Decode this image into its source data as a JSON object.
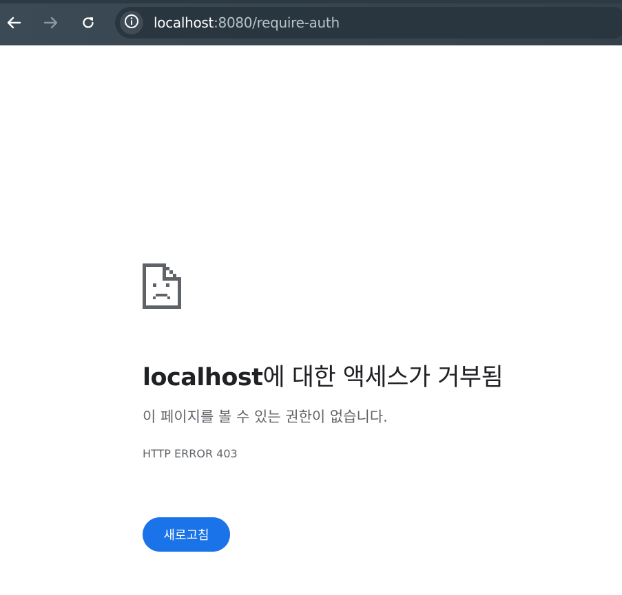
{
  "browser": {
    "url_host": "localhost",
    "url_rest": ":8080/require-auth",
    "icons": {
      "back": "back-arrow-icon",
      "forward": "forward-arrow-icon",
      "reload": "reload-icon",
      "site_info": "info-icon"
    }
  },
  "error_page": {
    "icon": "sad-document-icon",
    "headline_host": "localhost",
    "headline_rest": "에 대한 액세스가 거부됨",
    "subtext": "이 페이지를 볼 수 있는 권한이 없습니다.",
    "error_code": "HTTP ERROR 403",
    "reload_label": "새로고침"
  },
  "colors": {
    "toolbar": "#3b4a55",
    "omnibox": "#2a363f",
    "button": "#1a73e8",
    "headline": "#202124",
    "secondary_text": "#5f6368"
  }
}
